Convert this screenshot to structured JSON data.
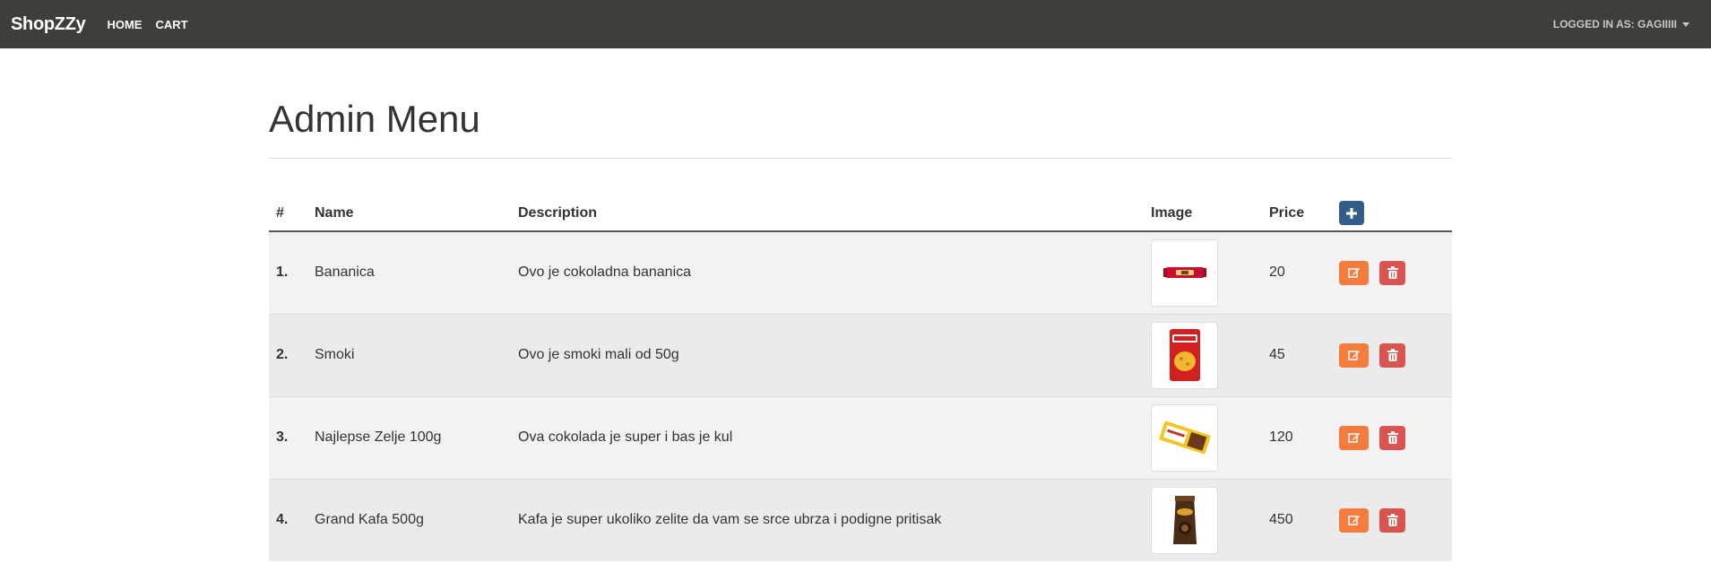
{
  "navbar": {
    "brand": "ShopZZy",
    "links": [
      "HOME",
      "CART"
    ],
    "user_label": "LOGGED IN AS: GAGIIIII"
  },
  "page": {
    "title": "Admin Menu"
  },
  "table": {
    "headers": [
      "#",
      "Name",
      "Description",
      "Image",
      "Price"
    ],
    "rows": [
      {
        "index": "1.",
        "name": "Bananica",
        "description": "Ovo je cokoladna bananica",
        "image": "bananica-thumbnail",
        "price": "20"
      },
      {
        "index": "2.",
        "name": "Smoki",
        "description": "Ovo je smoki mali od 50g",
        "image": "smoki-thumbnail",
        "price": "45"
      },
      {
        "index": "3.",
        "name": "Najlepse Zelje 100g",
        "description": "Ova cokolada je super i bas je kul",
        "image": "najlepse-zelje-thumbnail",
        "price": "120"
      },
      {
        "index": "4.",
        "name": "Grand Kafa 500g",
        "description": "Kafa je super ukoliko zelite da vam se srce ubrza i podigne pritisak",
        "image": "grand-kafa-thumbnail",
        "price": "450"
      }
    ]
  },
  "icons": {
    "add": "plus-icon",
    "edit": "edit-icon",
    "delete": "trash-icon",
    "user_menu": "caret-down-icon"
  },
  "colors": {
    "navbar": "#3e3f3a",
    "add_button": "#325d88",
    "edit_button": "#f47c3c",
    "delete_button": "#d9534f"
  }
}
